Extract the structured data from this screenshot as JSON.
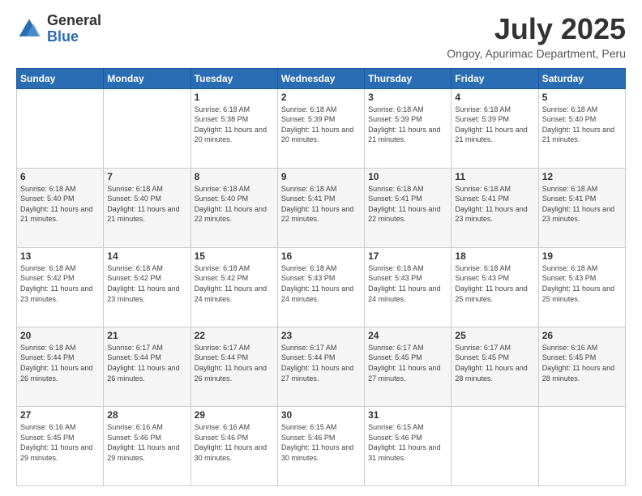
{
  "logo": {
    "general": "General",
    "blue": "Blue"
  },
  "title": {
    "month": "July 2025",
    "location": "Ongoy, Apurimac Department, Peru"
  },
  "weekdays": [
    "Sunday",
    "Monday",
    "Tuesday",
    "Wednesday",
    "Thursday",
    "Friday",
    "Saturday"
  ],
  "weeks": [
    [
      {
        "day": "",
        "sunrise": "",
        "sunset": "",
        "daylight": ""
      },
      {
        "day": "",
        "sunrise": "",
        "sunset": "",
        "daylight": ""
      },
      {
        "day": "1",
        "sunrise": "Sunrise: 6:18 AM",
        "sunset": "Sunset: 5:38 PM",
        "daylight": "Daylight: 11 hours and 20 minutes."
      },
      {
        "day": "2",
        "sunrise": "Sunrise: 6:18 AM",
        "sunset": "Sunset: 5:39 PM",
        "daylight": "Daylight: 11 hours and 20 minutes."
      },
      {
        "day": "3",
        "sunrise": "Sunrise: 6:18 AM",
        "sunset": "Sunset: 5:39 PM",
        "daylight": "Daylight: 11 hours and 21 minutes."
      },
      {
        "day": "4",
        "sunrise": "Sunrise: 6:18 AM",
        "sunset": "Sunset: 5:39 PM",
        "daylight": "Daylight: 11 hours and 21 minutes."
      },
      {
        "day": "5",
        "sunrise": "Sunrise: 6:18 AM",
        "sunset": "Sunset: 5:40 PM",
        "daylight": "Daylight: 11 hours and 21 minutes."
      }
    ],
    [
      {
        "day": "6",
        "sunrise": "Sunrise: 6:18 AM",
        "sunset": "Sunset: 5:40 PM",
        "daylight": "Daylight: 11 hours and 21 minutes."
      },
      {
        "day": "7",
        "sunrise": "Sunrise: 6:18 AM",
        "sunset": "Sunset: 5:40 PM",
        "daylight": "Daylight: 11 hours and 21 minutes."
      },
      {
        "day": "8",
        "sunrise": "Sunrise: 6:18 AM",
        "sunset": "Sunset: 5:40 PM",
        "daylight": "Daylight: 11 hours and 22 minutes."
      },
      {
        "day": "9",
        "sunrise": "Sunrise: 6:18 AM",
        "sunset": "Sunset: 5:41 PM",
        "daylight": "Daylight: 11 hours and 22 minutes."
      },
      {
        "day": "10",
        "sunrise": "Sunrise: 6:18 AM",
        "sunset": "Sunset: 5:41 PM",
        "daylight": "Daylight: 11 hours and 22 minutes."
      },
      {
        "day": "11",
        "sunrise": "Sunrise: 6:18 AM",
        "sunset": "Sunset: 5:41 PM",
        "daylight": "Daylight: 11 hours and 23 minutes."
      },
      {
        "day": "12",
        "sunrise": "Sunrise: 6:18 AM",
        "sunset": "Sunset: 5:41 PM",
        "daylight": "Daylight: 11 hours and 23 minutes."
      }
    ],
    [
      {
        "day": "13",
        "sunrise": "Sunrise: 6:18 AM",
        "sunset": "Sunset: 5:42 PM",
        "daylight": "Daylight: 11 hours and 23 minutes."
      },
      {
        "day": "14",
        "sunrise": "Sunrise: 6:18 AM",
        "sunset": "Sunset: 5:42 PM",
        "daylight": "Daylight: 11 hours and 23 minutes."
      },
      {
        "day": "15",
        "sunrise": "Sunrise: 6:18 AM",
        "sunset": "Sunset: 5:42 PM",
        "daylight": "Daylight: 11 hours and 24 minutes."
      },
      {
        "day": "16",
        "sunrise": "Sunrise: 6:18 AM",
        "sunset": "Sunset: 5:43 PM",
        "daylight": "Daylight: 11 hours and 24 minutes."
      },
      {
        "day": "17",
        "sunrise": "Sunrise: 6:18 AM",
        "sunset": "Sunset: 5:43 PM",
        "daylight": "Daylight: 11 hours and 24 minutes."
      },
      {
        "day": "18",
        "sunrise": "Sunrise: 6:18 AM",
        "sunset": "Sunset: 5:43 PM",
        "daylight": "Daylight: 11 hours and 25 minutes."
      },
      {
        "day": "19",
        "sunrise": "Sunrise: 6:18 AM",
        "sunset": "Sunset: 5:43 PM",
        "daylight": "Daylight: 11 hours and 25 minutes."
      }
    ],
    [
      {
        "day": "20",
        "sunrise": "Sunrise: 6:18 AM",
        "sunset": "Sunset: 5:44 PM",
        "daylight": "Daylight: 11 hours and 26 minutes."
      },
      {
        "day": "21",
        "sunrise": "Sunrise: 6:17 AM",
        "sunset": "Sunset: 5:44 PM",
        "daylight": "Daylight: 11 hours and 26 minutes."
      },
      {
        "day": "22",
        "sunrise": "Sunrise: 6:17 AM",
        "sunset": "Sunset: 5:44 PM",
        "daylight": "Daylight: 11 hours and 26 minutes."
      },
      {
        "day": "23",
        "sunrise": "Sunrise: 6:17 AM",
        "sunset": "Sunset: 5:44 PM",
        "daylight": "Daylight: 11 hours and 27 minutes."
      },
      {
        "day": "24",
        "sunrise": "Sunrise: 6:17 AM",
        "sunset": "Sunset: 5:45 PM",
        "daylight": "Daylight: 11 hours and 27 minutes."
      },
      {
        "day": "25",
        "sunrise": "Sunrise: 6:17 AM",
        "sunset": "Sunset: 5:45 PM",
        "daylight": "Daylight: 11 hours and 28 minutes."
      },
      {
        "day": "26",
        "sunrise": "Sunrise: 6:16 AM",
        "sunset": "Sunset: 5:45 PM",
        "daylight": "Daylight: 11 hours and 28 minutes."
      }
    ],
    [
      {
        "day": "27",
        "sunrise": "Sunrise: 6:16 AM",
        "sunset": "Sunset: 5:45 PM",
        "daylight": "Daylight: 11 hours and 29 minutes."
      },
      {
        "day": "28",
        "sunrise": "Sunrise: 6:16 AM",
        "sunset": "Sunset: 5:46 PM",
        "daylight": "Daylight: 11 hours and 29 minutes."
      },
      {
        "day": "29",
        "sunrise": "Sunrise: 6:16 AM",
        "sunset": "Sunset: 5:46 PM",
        "daylight": "Daylight: 11 hours and 30 minutes."
      },
      {
        "day": "30",
        "sunrise": "Sunrise: 6:15 AM",
        "sunset": "Sunset: 5:46 PM",
        "daylight": "Daylight: 11 hours and 30 minutes."
      },
      {
        "day": "31",
        "sunrise": "Sunrise: 6:15 AM",
        "sunset": "Sunset: 5:46 PM",
        "daylight": "Daylight: 11 hours and 31 minutes."
      },
      {
        "day": "",
        "sunrise": "",
        "sunset": "",
        "daylight": ""
      },
      {
        "day": "",
        "sunrise": "",
        "sunset": "",
        "daylight": ""
      }
    ]
  ]
}
